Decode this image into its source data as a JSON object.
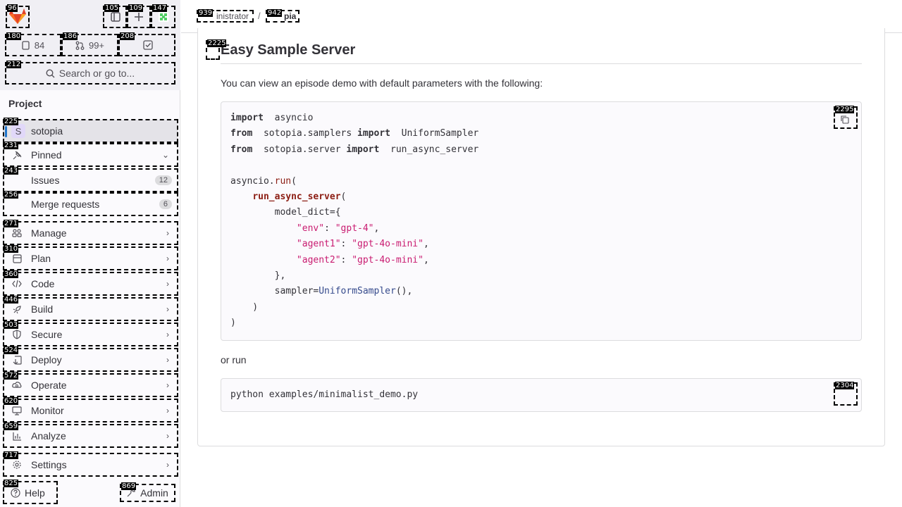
{
  "header": {
    "breadcrumb_parent": "inistrator",
    "breadcrumb_sep": "/",
    "breadcrumb_current": "pia"
  },
  "top_buttons": {
    "issues_count": "84",
    "merge_requests_count": "99+",
    "search_label": "Search or go to..."
  },
  "sidebar": {
    "section_title": "Project",
    "project_initial": "S",
    "project_name": "sotopia",
    "items": [
      {
        "label": "Pinned"
      },
      {
        "label": "Issues",
        "badge": "12"
      },
      {
        "label": "Merge requests",
        "badge": "6"
      },
      {
        "label": "Manage"
      },
      {
        "label": "Plan"
      },
      {
        "label": "Code"
      },
      {
        "label": "Build"
      },
      {
        "label": "Secure"
      },
      {
        "label": "Deploy"
      },
      {
        "label": "Operate"
      },
      {
        "label": "Monitor"
      },
      {
        "label": "Analyze"
      },
      {
        "label": "Settings"
      }
    ],
    "help_label": "Help",
    "admin_label": "Admin"
  },
  "content": {
    "heading": "Easy Sample Server",
    "intro": "You can view an episode demo with default parameters with the following:",
    "code_block_1": [
      [
        [
          "kw",
          "import"
        ],
        [
          "",
          "  asyncio"
        ]
      ],
      [
        [
          "kw",
          "from"
        ],
        [
          "",
          "  sotopia.samplers "
        ],
        [
          "kw",
          "import"
        ],
        [
          "",
          "  UniformSampler"
        ]
      ],
      [
        [
          "kw",
          "from"
        ],
        [
          "",
          "  sotopia.server "
        ],
        [
          "kw",
          "import"
        ],
        [
          "",
          "  run_async_server"
        ]
      ],
      [],
      [
        [
          "",
          "asyncio."
        ],
        [
          "fnr",
          "run"
        ],
        [
          "",
          "("
        ]
      ],
      [
        [
          "",
          "    "
        ],
        [
          "fn",
          "run_async_server"
        ],
        [
          "",
          "("
        ]
      ],
      [
        [
          "",
          "        model_dict={"
        ]
      ],
      [
        [
          "",
          "            "
        ],
        [
          "str",
          "\"env\""
        ],
        [
          "",
          ": "
        ],
        [
          "str",
          "\"gpt-4\""
        ],
        [
          "",
          ","
        ]
      ],
      [
        [
          "",
          "            "
        ],
        [
          "str",
          "\"agent1\""
        ],
        [
          "",
          ": "
        ],
        [
          "str",
          "\"gpt-4o-mini\""
        ],
        [
          "",
          ","
        ]
      ],
      [
        [
          "",
          "            "
        ],
        [
          "str",
          "\"agent2\""
        ],
        [
          "",
          ": "
        ],
        [
          "str",
          "\"gpt-4o-mini\""
        ],
        [
          "",
          ","
        ]
      ],
      [
        [
          "",
          "        },"
        ]
      ],
      [
        [
          "",
          "        sampler="
        ],
        [
          "cls",
          "UniformSampler"
        ],
        [
          "",
          "(),"
        ]
      ],
      [
        [
          "",
          "    )"
        ]
      ],
      [
        [
          "",
          ")"
        ]
      ]
    ],
    "or_run": "or run",
    "code_block_2": "python examples/minimalist_demo.py"
  },
  "markers": {
    "m96": "96",
    "m105": "105",
    "m109": "109",
    "m147": "147",
    "m180": "180",
    "m186": "186",
    "m208": "208",
    "m212": "212",
    "m225": "225",
    "m231": "231",
    "m243": "243",
    "m256": "256",
    "m271": "271",
    "m310": "310",
    "m360": "360",
    "m446": "446",
    "m503": "503",
    "m524": "524",
    "m572": "572",
    "m620": "620",
    "m659": "659",
    "m717": "717",
    "m825": "825",
    "m869": "869",
    "m939": "939",
    "m942": "942",
    "m2225": "2225",
    "m2295": "2295",
    "m2304": "2304"
  },
  "colors": {
    "accent": "#1f75cb",
    "logo_orange": "#e24329",
    "string": "#c91c71",
    "function": "#8c1d13",
    "class": "#354a8c"
  }
}
